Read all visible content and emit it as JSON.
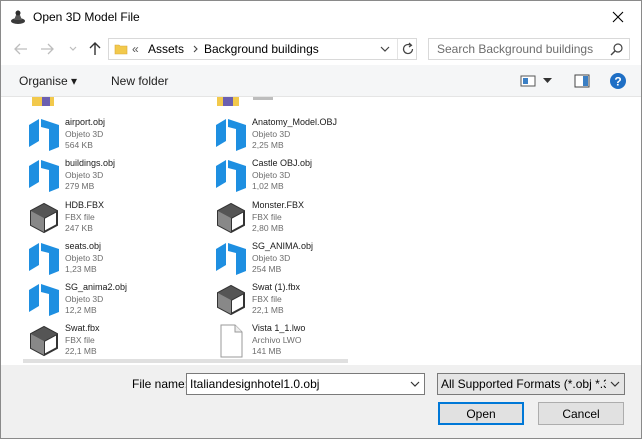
{
  "window": {
    "title": "Open 3D Model File"
  },
  "address": {
    "prefix": "«",
    "crumb1": "Assets",
    "crumb2": "Background buildings"
  },
  "search": {
    "placeholder": "Search Background buildings"
  },
  "toolbar": {
    "organise": "Organise ▾",
    "new_folder": "New folder"
  },
  "files": [
    {
      "name": "airport.obj",
      "type": "Objeto 3D",
      "size": "564 KB",
      "icon": "obj-file-icon"
    },
    {
      "name": "Anatomy_Model.OBJ",
      "type": "Objeto 3D",
      "size": "2,25 MB",
      "icon": "obj-file-icon"
    },
    {
      "name": "buildings.obj",
      "type": "Objeto 3D",
      "size": "279 MB",
      "icon": "obj-file-icon"
    },
    {
      "name": "Castle OBJ.obj",
      "type": "Objeto 3D",
      "size": "1,02 MB",
      "icon": "obj-file-icon"
    },
    {
      "name": "HDB.FBX",
      "type": "FBX file",
      "size": "247 KB",
      "icon": "fbx-file-icon"
    },
    {
      "name": "Monster.FBX",
      "type": "FBX file",
      "size": "2,80 MB",
      "icon": "fbx-file-icon"
    },
    {
      "name": "seats.obj",
      "type": "Objeto 3D",
      "size": "1,23 MB",
      "icon": "obj-file-icon"
    },
    {
      "name": "SG_ANIMA.obj",
      "type": "Objeto 3D",
      "size": "254 MB",
      "icon": "obj-file-icon"
    },
    {
      "name": "SG_anima2.obj",
      "type": "Objeto 3D",
      "size": "12,2 MB",
      "icon": "obj-file-icon"
    },
    {
      "name": "Swat (1).fbx",
      "type": "FBX file",
      "size": "22,1 MB",
      "icon": "fbx-file-icon"
    },
    {
      "name": "Swat.fbx",
      "type": "FBX file",
      "size": "22,1 MB",
      "icon": "fbx-file-icon"
    },
    {
      "name": "Vista 1_1.lwo",
      "type": "Archivo LWO",
      "size": "141 MB",
      "icon": "blank-file-icon"
    }
  ],
  "bottom": {
    "filename_label": "File name:",
    "filename_value": "Italiandesignhotel1.0.obj",
    "filetype_value": "All Supported Formats (*.obj *.3",
    "open_label": "Open",
    "cancel_label": "Cancel"
  },
  "colors": {
    "accent": "#0078d7",
    "obj_icon": "#1e8fe1",
    "folder": "#f2c94c"
  }
}
